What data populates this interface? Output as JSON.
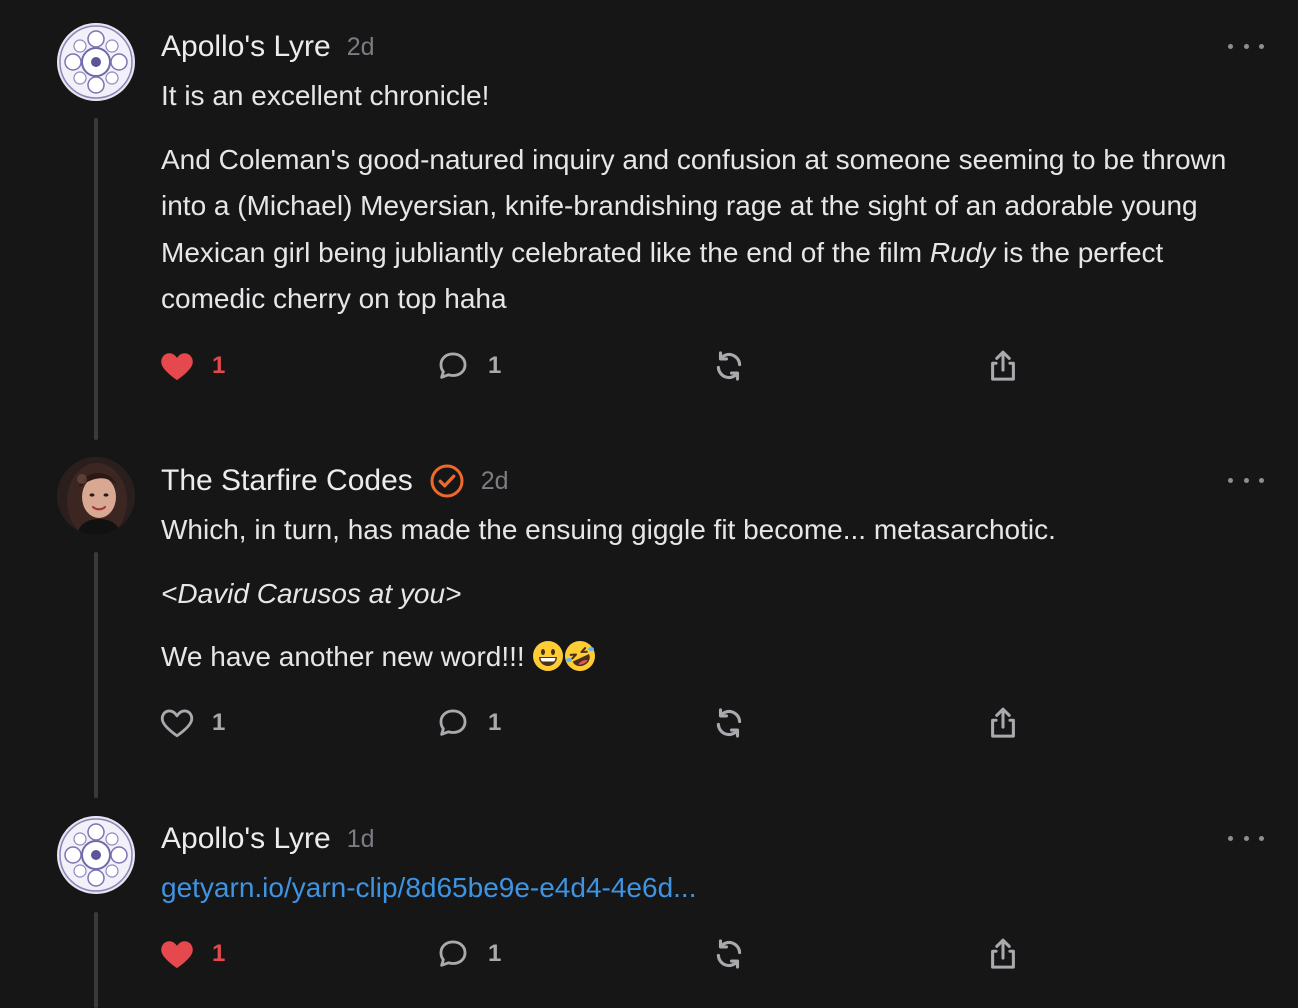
{
  "comments": [
    {
      "author": "Apollo's Lyre",
      "time": "2d",
      "verified": false,
      "paragraph1": "It is an excellent chronicle!",
      "paragraph2": "And Coleman's good-natured inquiry and confusion at someone seeming to be thrown into a (Michael) Meyersian, knife-brandishing rage at the sight of an adorable young Mexican girl being jubliantly celebrated like the end of the film",
      "paragraph2_italic": "Rudy",
      "paragraph2_tail": " is the perfect comedic cherry on top haha",
      "likes": "1",
      "liked": true,
      "replies": "1"
    },
    {
      "author": "The Starfire Codes",
      "time": "2d",
      "verified": true,
      "paragraph1": "Which, in turn, has made the ensuing giggle fit become... metasarchotic.",
      "paragraph2": "<David Carusos at you>",
      "paragraph3": "We have another new word!!!",
      "likes": "1",
      "liked": false,
      "replies": "1"
    },
    {
      "author": "Apollo's Lyre",
      "time": "1d",
      "verified": false,
      "link": "getyarn.io/yarn-clip/8d65be9e-e4d4-4e6d...",
      "likes": "1",
      "liked": true,
      "replies": "1"
    }
  ],
  "icons": {
    "like_filled": "heart-filled-icon",
    "like_outline": "heart-outline-icon",
    "reply": "comment-bubble-icon",
    "restack": "restack-icon",
    "share": "share-icon",
    "more": "more-dots-icon",
    "verified": "verified-badge-icon"
  },
  "colors": {
    "background": "#161617",
    "liked": "#e5484d",
    "link": "#3e94e1",
    "verified": "#f0692a",
    "muted": "#7c7c82"
  }
}
